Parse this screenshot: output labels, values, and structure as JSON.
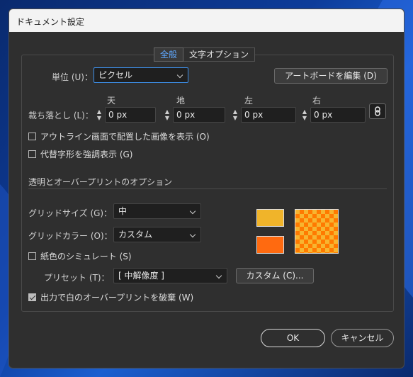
{
  "window": {
    "title": "ドキュメント設定"
  },
  "tabs": [
    {
      "label": "全般",
      "active": true
    },
    {
      "label": "文字オプション",
      "active": false
    }
  ],
  "units": {
    "label": "単位 (U)：",
    "value": "ピクセル"
  },
  "artboard_button": "アートボードを編集 (D)",
  "bleed": {
    "label": "裁ち落とし (L)：",
    "fields": [
      {
        "header": "天",
        "value": "0 px"
      },
      {
        "header": "地",
        "value": "0 px"
      },
      {
        "header": "左",
        "value": "0 px"
      },
      {
        "header": "右",
        "value": "0 px"
      }
    ],
    "link_icon": "link-chain-icon"
  },
  "checks": {
    "outline": {
      "label": "アウトライン画面で配置した画像を表示 (O)",
      "checked": false
    },
    "glyphs": {
      "label": "代替字形を強調表示 (G)",
      "checked": false
    }
  },
  "transparency": {
    "section_title": "透明とオーバープリントのオプション",
    "grid_size": {
      "label": "グリッドサイズ (G)：",
      "value": "中"
    },
    "grid_color": {
      "label": "グリッドカラー (O)：",
      "value": "カスタム"
    },
    "simulate_paper": {
      "label": "紙色のシミュレート (S)",
      "checked": false
    },
    "preset": {
      "label": "プリセット (T)：",
      "value": "[ 中解像度 ]"
    },
    "custom_button": "カスタム (C)...",
    "discard_overprint": {
      "label": "出力で白のオーバープリントを破棄 (W)",
      "checked": true
    },
    "colors": {
      "top_swatch": "#f0b42a",
      "bottom_swatch": "#ff6a10",
      "checker_a": "#ff7a00",
      "checker_b": "#f7b530"
    }
  },
  "footer": {
    "ok": "OK",
    "cancel": "キャンセル"
  }
}
